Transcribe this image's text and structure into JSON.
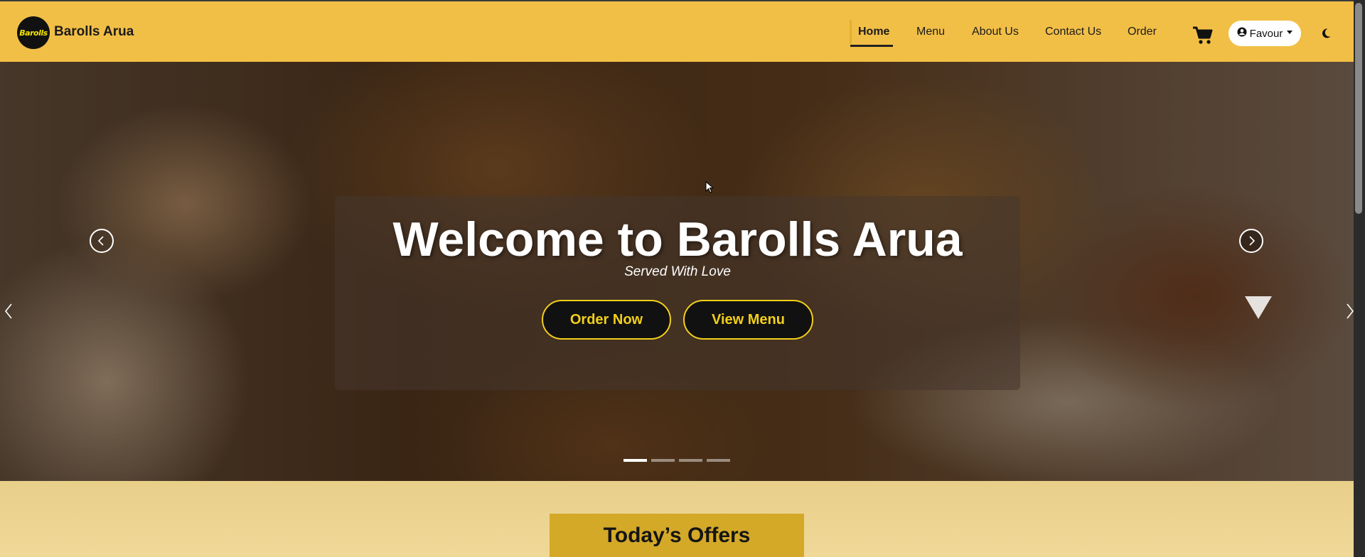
{
  "navbar": {
    "logo_text": "Barolls",
    "brand": "Barolls Arua",
    "links": [
      {
        "label": "Home",
        "active": true
      },
      {
        "label": "Menu",
        "active": false
      },
      {
        "label": "About Us",
        "active": false
      },
      {
        "label": "Contact Us",
        "active": false
      },
      {
        "label": "Order",
        "active": false
      }
    ],
    "cart_icon": "cart-icon",
    "user_menu": {
      "icon": "user-circle-icon",
      "label": "Favour"
    },
    "theme_toggle_icon": "moon-icon",
    "colors": {
      "background": "#f2bf46"
    }
  },
  "hero": {
    "title": "Welcome to Barolls Arua",
    "subtitle": "Served With Love",
    "buttons": {
      "order": "Order Now",
      "view_menu": "View Menu"
    },
    "carousel": {
      "slide_count": 4,
      "active_index": 0
    },
    "colors": {
      "button_border": "#f2cf1a",
      "button_bg": "#111111"
    }
  },
  "offers": {
    "heading": "Today’s Offers",
    "colors": {
      "tab": "#d4a928"
    }
  }
}
